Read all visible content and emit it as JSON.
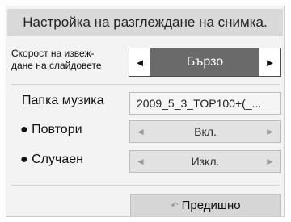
{
  "title": "Настройка на разглеждане на снимка.",
  "slideshow_speed": {
    "label_line1": "Скорост на извеж-",
    "label_line2": "дане на слайдовете",
    "value": "Бързо",
    "left_arrow": "◄",
    "right_arrow": "►"
  },
  "music_folder": {
    "label": "Папка музика",
    "value": "2009_5_3_TOP100+(_..."
  },
  "repeat": {
    "label": "● Повтори",
    "value": "Вкл.",
    "left_arrow": "◄",
    "right_arrow": "►"
  },
  "shuffle": {
    "label": "● Случаен",
    "value": "Изкл.",
    "left_arrow": "◄",
    "right_arrow": "►"
  },
  "back_button": {
    "icon": "return-icon",
    "label": "Предишно"
  }
}
